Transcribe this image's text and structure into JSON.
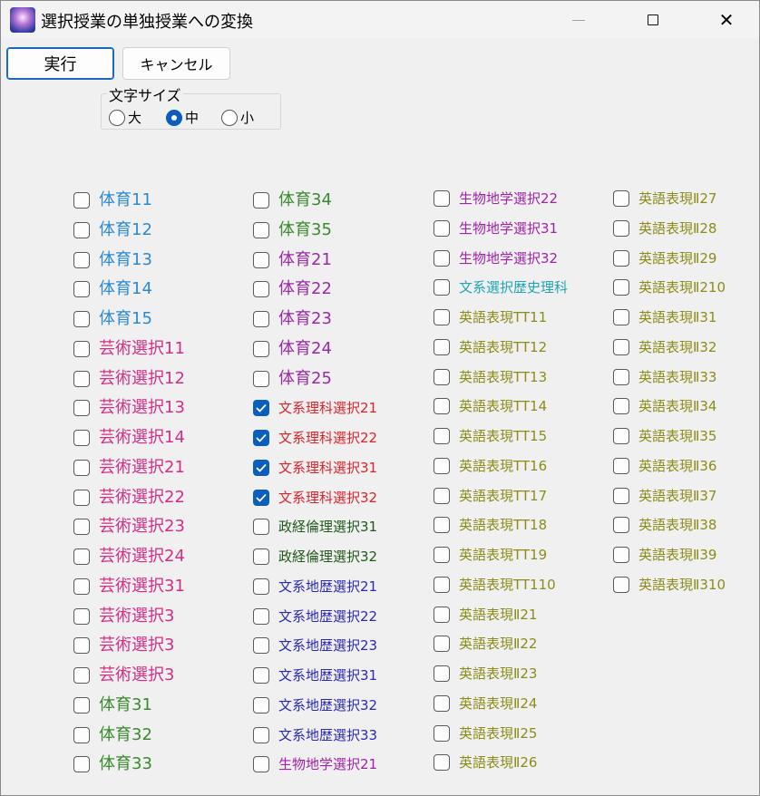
{
  "window": {
    "title": "選択授業の単独授業への変換"
  },
  "buttons": {
    "run": "実行",
    "cancel": "キャンセル"
  },
  "fontsize": {
    "label": "文字サイズ",
    "options": [
      {
        "label": "大",
        "selected": false
      },
      {
        "label": "中",
        "selected": true
      },
      {
        "label": "小",
        "selected": false
      }
    ]
  },
  "colors": {
    "blue": "#2a8ad6",
    "pink": "#d62d86",
    "green": "#3a8a2e",
    "purple": "#9a2aa8",
    "red": "#e0222a",
    "darkgreen": "#1e5a1a",
    "navy": "#2a2ab8",
    "violet": "#a023a8",
    "teal": "#1ea6b4",
    "olive": "#8c8c1a"
  },
  "columns": [
    {
      "items": [
        {
          "label": "体育11",
          "checked": false,
          "color": "blue"
        },
        {
          "label": "体育12",
          "checked": false,
          "color": "blue"
        },
        {
          "label": "体育13",
          "checked": false,
          "color": "blue"
        },
        {
          "label": "体育14",
          "checked": false,
          "color": "blue"
        },
        {
          "label": "体育15",
          "checked": false,
          "color": "blue"
        },
        {
          "label": "芸術選択11",
          "checked": false,
          "color": "pink"
        },
        {
          "label": "芸術選択12",
          "checked": false,
          "color": "pink"
        },
        {
          "label": "芸術選択13",
          "checked": false,
          "color": "pink"
        },
        {
          "label": "芸術選択14",
          "checked": false,
          "color": "pink"
        },
        {
          "label": "芸術選択21",
          "checked": false,
          "color": "pink"
        },
        {
          "label": "芸術選択22",
          "checked": false,
          "color": "pink"
        },
        {
          "label": "芸術選択23",
          "checked": false,
          "color": "pink"
        },
        {
          "label": "芸術選択24",
          "checked": false,
          "color": "pink"
        },
        {
          "label": "芸術選択31",
          "checked": false,
          "color": "pink"
        },
        {
          "label": "芸術選択3",
          "checked": false,
          "color": "pink"
        },
        {
          "label": "芸術選択3",
          "checked": false,
          "color": "pink"
        },
        {
          "label": "芸術選択3",
          "checked": false,
          "color": "pink"
        },
        {
          "label": "体育31",
          "checked": false,
          "color": "green"
        },
        {
          "label": "体育32",
          "checked": false,
          "color": "green"
        },
        {
          "label": "体育33",
          "checked": false,
          "color": "green"
        }
      ]
    },
    {
      "items": [
        {
          "label": "体育34",
          "checked": false,
          "color": "green"
        },
        {
          "label": "体育35",
          "checked": false,
          "color": "green"
        },
        {
          "label": "体育21",
          "checked": false,
          "color": "purple"
        },
        {
          "label": "体育22",
          "checked": false,
          "color": "purple"
        },
        {
          "label": "体育23",
          "checked": false,
          "color": "purple"
        },
        {
          "label": "体育24",
          "checked": false,
          "color": "purple"
        },
        {
          "label": "体育25",
          "checked": false,
          "color": "purple"
        },
        {
          "label": "文系理科選択21",
          "checked": true,
          "color": "red"
        },
        {
          "label": "文系理科選択22",
          "checked": true,
          "color": "red"
        },
        {
          "label": "文系理科選択31",
          "checked": true,
          "color": "red"
        },
        {
          "label": "文系理科選択32",
          "checked": true,
          "color": "red"
        },
        {
          "label": "政経倫理選択31",
          "checked": false,
          "color": "darkgreen"
        },
        {
          "label": "政経倫理選択32",
          "checked": false,
          "color": "darkgreen"
        },
        {
          "label": "文系地歴選択21",
          "checked": false,
          "color": "navy"
        },
        {
          "label": "文系地歴選択22",
          "checked": false,
          "color": "navy"
        },
        {
          "label": "文系地歴選択23",
          "checked": false,
          "color": "navy"
        },
        {
          "label": "文系地歴選択31",
          "checked": false,
          "color": "navy"
        },
        {
          "label": "文系地歴選択32",
          "checked": false,
          "color": "navy"
        },
        {
          "label": "文系地歴選択33",
          "checked": false,
          "color": "navy"
        },
        {
          "label": "生物地学選択21",
          "checked": false,
          "color": "violet"
        }
      ]
    },
    {
      "items": [
        {
          "label": "生物地学選択22",
          "checked": false,
          "color": "violet"
        },
        {
          "label": "生物地学選択31",
          "checked": false,
          "color": "violet"
        },
        {
          "label": "生物地学選択32",
          "checked": false,
          "color": "violet"
        },
        {
          "label": "文系選択歴史理科",
          "checked": false,
          "color": "teal"
        },
        {
          "label": "英語表現TT11",
          "checked": false,
          "color": "olive"
        },
        {
          "label": "英語表現TT12",
          "checked": false,
          "color": "olive"
        },
        {
          "label": "英語表現TT13",
          "checked": false,
          "color": "olive"
        },
        {
          "label": "英語表現TT14",
          "checked": false,
          "color": "olive"
        },
        {
          "label": "英語表現TT15",
          "checked": false,
          "color": "olive"
        },
        {
          "label": "英語表現TT16",
          "checked": false,
          "color": "olive"
        },
        {
          "label": "英語表現TT17",
          "checked": false,
          "color": "olive"
        },
        {
          "label": "英語表現TT18",
          "checked": false,
          "color": "olive"
        },
        {
          "label": "英語表現TT19",
          "checked": false,
          "color": "olive"
        },
        {
          "label": "英語表現TT110",
          "checked": false,
          "color": "olive"
        },
        {
          "label": "英語表現Ⅱ21",
          "checked": false,
          "color": "olive"
        },
        {
          "label": "英語表現Ⅱ22",
          "checked": false,
          "color": "olive"
        },
        {
          "label": "英語表現Ⅱ23",
          "checked": false,
          "color": "olive"
        },
        {
          "label": "英語表現Ⅱ24",
          "checked": false,
          "color": "olive"
        },
        {
          "label": "英語表現Ⅱ25",
          "checked": false,
          "color": "olive"
        },
        {
          "label": "英語表現Ⅱ26",
          "checked": false,
          "color": "olive"
        }
      ]
    },
    {
      "items": [
        {
          "label": "英語表現Ⅱ27",
          "checked": false,
          "color": "olive"
        },
        {
          "label": "英語表現Ⅱ28",
          "checked": false,
          "color": "olive"
        },
        {
          "label": "英語表現Ⅱ29",
          "checked": false,
          "color": "olive"
        },
        {
          "label": "英語表現Ⅱ210",
          "checked": false,
          "color": "olive"
        },
        {
          "label": "英語表現Ⅱ31",
          "checked": false,
          "color": "olive"
        },
        {
          "label": "英語表現Ⅱ32",
          "checked": false,
          "color": "olive"
        },
        {
          "label": "英語表現Ⅱ33",
          "checked": false,
          "color": "olive"
        },
        {
          "label": "英語表現Ⅱ34",
          "checked": false,
          "color": "olive"
        },
        {
          "label": "英語表現Ⅱ35",
          "checked": false,
          "color": "olive"
        },
        {
          "label": "英語表現Ⅱ36",
          "checked": false,
          "color": "olive"
        },
        {
          "label": "英語表現Ⅱ37",
          "checked": false,
          "color": "olive"
        },
        {
          "label": "英語表現Ⅱ38",
          "checked": false,
          "color": "olive"
        },
        {
          "label": "英語表現Ⅱ39",
          "checked": false,
          "color": "olive"
        },
        {
          "label": "英語表現Ⅱ310",
          "checked": false,
          "color": "olive"
        }
      ]
    }
  ]
}
